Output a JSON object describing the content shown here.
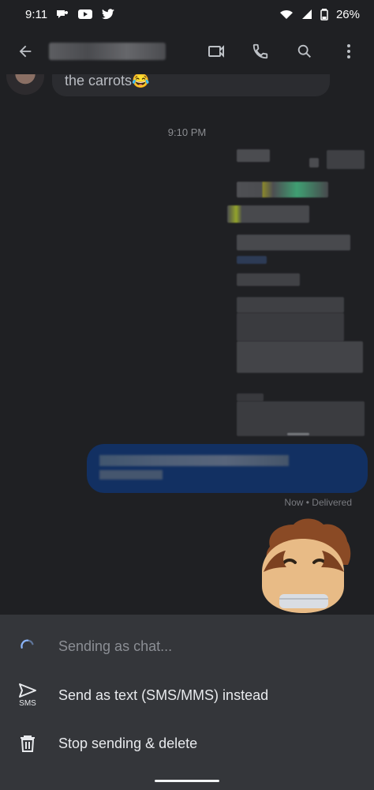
{
  "status_bar": {
    "time": "9:11",
    "battery": "26%",
    "icons": [
      "messenger-icon",
      "youtube-icon",
      "twitter-icon",
      "wifi-icon",
      "signal-icon",
      "battery-icon"
    ]
  },
  "app_bar": {
    "icons": [
      "back-arrow-icon",
      "video-call-icon",
      "phone-icon",
      "search-icon",
      "more-vert-icon"
    ]
  },
  "conversation": {
    "incoming_message": "the carrots😂",
    "timestamp": "9:10 PM",
    "delivery_status": "Now • Delivered"
  },
  "sheet": {
    "items": [
      {
        "icon": "loading-spinner-icon",
        "label": "Sending as chat..."
      },
      {
        "icon": "send-icon",
        "sub_label": "SMS",
        "label": "Send as text (SMS/MMS) instead"
      },
      {
        "icon": "trash-icon",
        "label": "Stop sending & delete"
      }
    ]
  },
  "colors": {
    "background": "#1f2023",
    "sheet": "#34363a",
    "outgoing_bubble": "#123062",
    "spinner": "#8ab4f8"
  }
}
